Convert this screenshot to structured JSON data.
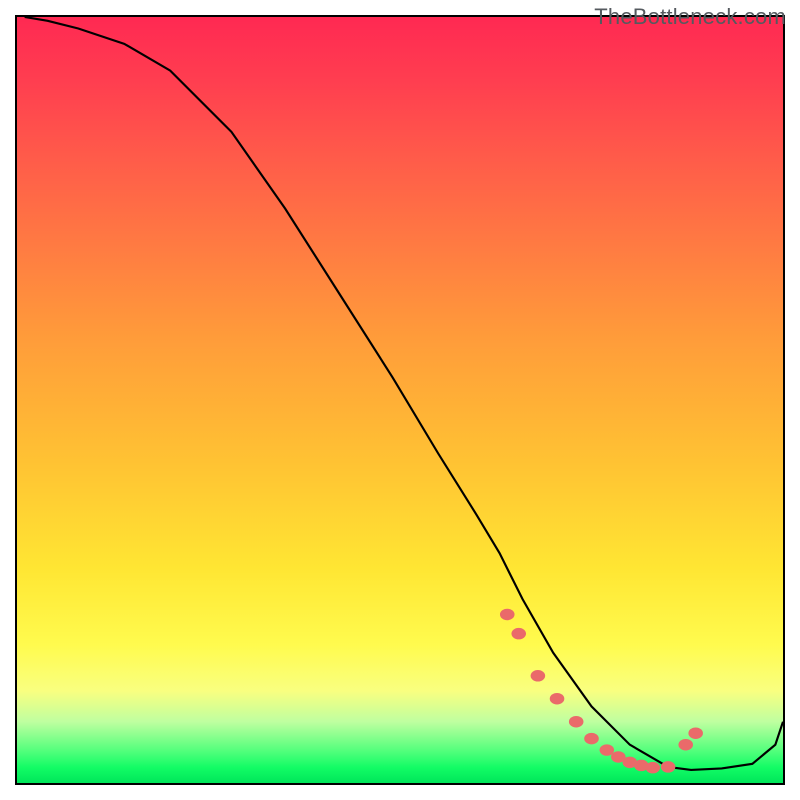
{
  "watermark": "TheBottleneck.com",
  "chart_data": {
    "type": "line",
    "title": "",
    "xlabel": "",
    "ylabel": "",
    "xlim": [
      0,
      100
    ],
    "ylim": [
      0,
      100
    ],
    "grid": false,
    "legend": false,
    "series": [
      {
        "name": "curve",
        "x": [
          1,
          4,
          8,
          14,
          20,
          28,
          35,
          42,
          49,
          55,
          60,
          63,
          66,
          70,
          75,
          80,
          85,
          88,
          92,
          96,
          99,
          100
        ],
        "y": [
          100,
          99.5,
          98.5,
          96.5,
          93,
          85,
          75,
          64,
          53,
          43,
          35,
          30,
          24,
          17,
          10,
          5,
          2.1,
          1.7,
          1.9,
          2.5,
          5,
          8
        ]
      }
    ],
    "markers": {
      "name": "dots",
      "color": "#ea6a6a",
      "x": [
        64.0,
        65.5,
        68.0,
        70.5,
        73.0,
        75.0,
        77.0,
        78.5,
        80.0,
        81.5,
        83.0,
        85.0,
        87.3,
        88.6
      ],
      "y": [
        22.0,
        19.5,
        14.0,
        11.0,
        8.0,
        5.8,
        4.3,
        3.4,
        2.7,
        2.3,
        2.0,
        2.1,
        5.0,
        6.5
      ]
    },
    "gradient_stops": [
      {
        "pos": 0.0,
        "color": "#ff2952"
      },
      {
        "pos": 0.18,
        "color": "#ff5a4a"
      },
      {
        "pos": 0.42,
        "color": "#ff9c3a"
      },
      {
        "pos": 0.72,
        "color": "#ffe633"
      },
      {
        "pos": 0.88,
        "color": "#f9ff80"
      },
      {
        "pos": 0.96,
        "color": "#4dff7a"
      },
      {
        "pos": 1.0,
        "color": "#00e65a"
      }
    ]
  }
}
